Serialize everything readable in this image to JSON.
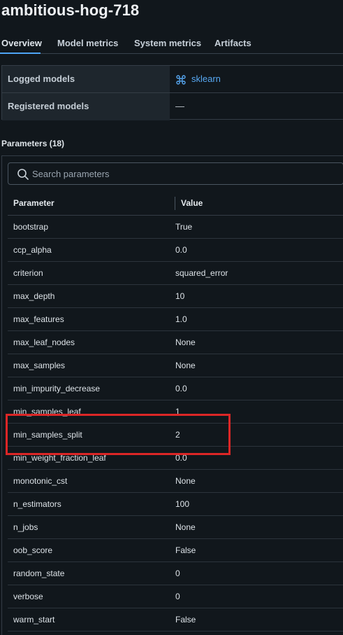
{
  "run": {
    "title": "ambitious-hog-718"
  },
  "tabs": [
    {
      "label": "Overview",
      "active": true
    },
    {
      "label": "Model metrics",
      "active": false
    },
    {
      "label": "System metrics",
      "active": false
    },
    {
      "label": "Artifacts",
      "active": false
    }
  ],
  "info": {
    "logged_models_label": "Logged models",
    "logged_models_value": "sklearn",
    "registered_models_label": "Registered models",
    "registered_models_value": "—"
  },
  "params": {
    "header": "Parameters (18)",
    "search_placeholder": "Search parameters",
    "col_parameter": "Parameter",
    "col_value": "Value",
    "rows": [
      {
        "name": "bootstrap",
        "value": "True"
      },
      {
        "name": "ccp_alpha",
        "value": "0.0"
      },
      {
        "name": "criterion",
        "value": "squared_error"
      },
      {
        "name": "max_depth",
        "value": "10"
      },
      {
        "name": "max_features",
        "value": "1.0"
      },
      {
        "name": "max_leaf_nodes",
        "value": "None"
      },
      {
        "name": "max_samples",
        "value": "None"
      },
      {
        "name": "min_impurity_decrease",
        "value": "0.0"
      },
      {
        "name": "min_samples_leaf",
        "value": "1"
      },
      {
        "name": "min_samples_split",
        "value": "2"
      },
      {
        "name": "min_weight_fraction_leaf",
        "value": "0.0"
      },
      {
        "name": "monotonic_cst",
        "value": "None"
      },
      {
        "name": "n_estimators",
        "value": "100"
      },
      {
        "name": "n_jobs",
        "value": "None"
      },
      {
        "name": "oob_score",
        "value": "False"
      },
      {
        "name": "random_state",
        "value": "0"
      },
      {
        "name": "verbose",
        "value": "0"
      },
      {
        "name": "warm_start",
        "value": "False"
      }
    ]
  },
  "colors": {
    "accent": "#4ea4f5",
    "link": "#57a8f2",
    "highlight": "#dc2626",
    "background": "#11171c"
  }
}
